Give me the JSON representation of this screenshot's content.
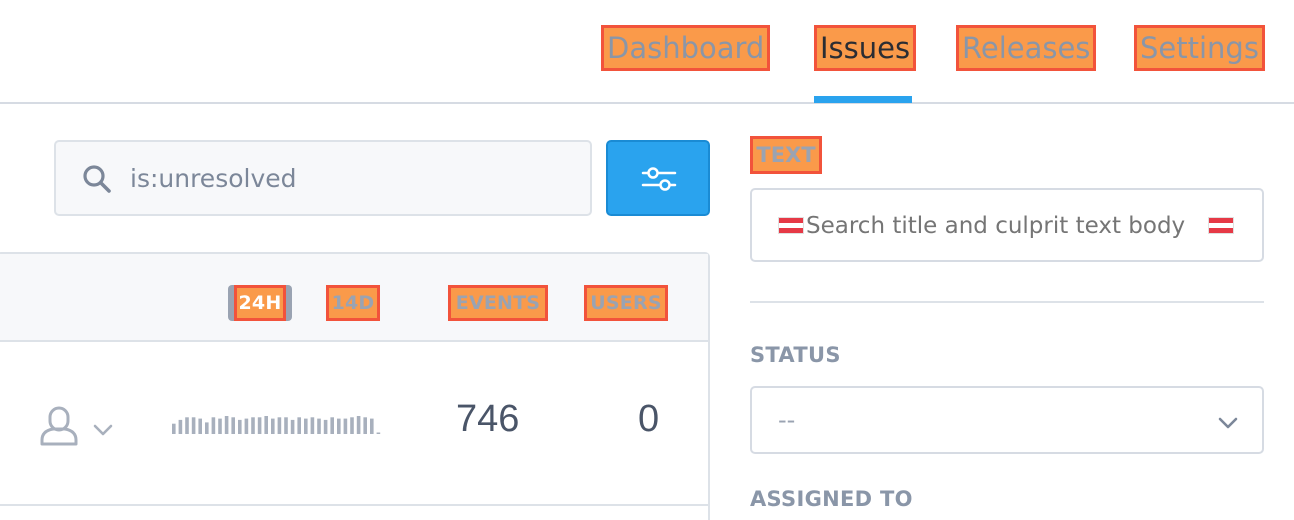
{
  "nav": {
    "tabs": [
      {
        "label": "Dashboard",
        "active": false
      },
      {
        "label": "Issues",
        "active": true
      },
      {
        "label": "Releases",
        "active": false
      },
      {
        "label": "Settings",
        "active": false
      }
    ]
  },
  "search": {
    "value": "is:unresolved",
    "icon": "search-icon"
  },
  "filter_button": {
    "icon": "sliders-icon"
  },
  "table": {
    "headers": {
      "period_24h": "24H",
      "period_14d": "14D",
      "events": "EVENTS",
      "users": "USERS"
    },
    "selected_period": "24H",
    "rows": [
      {
        "assignee_icon": "user-icon",
        "events": "746",
        "users": "0",
        "sparkline": [
          8,
          11,
          13,
          13,
          12,
          9,
          13,
          12,
          14,
          13,
          11,
          12,
          13,
          13,
          14,
          12,
          13,
          13,
          11,
          13,
          12,
          13,
          12,
          11,
          13,
          12,
          12,
          13,
          14,
          13,
          12,
          1
        ]
      }
    ]
  },
  "sidebar": {
    "text_label": "TEXT",
    "text_placeholder": "Search title and culprit text body",
    "status_label": "STATUS",
    "status_value": "--",
    "assigned_label": "ASSIGNED TO"
  },
  "colors": {
    "accent": "#2aa3ee",
    "highlight_fill": "#fa9a4a",
    "highlight_border": "#f2533b"
  }
}
